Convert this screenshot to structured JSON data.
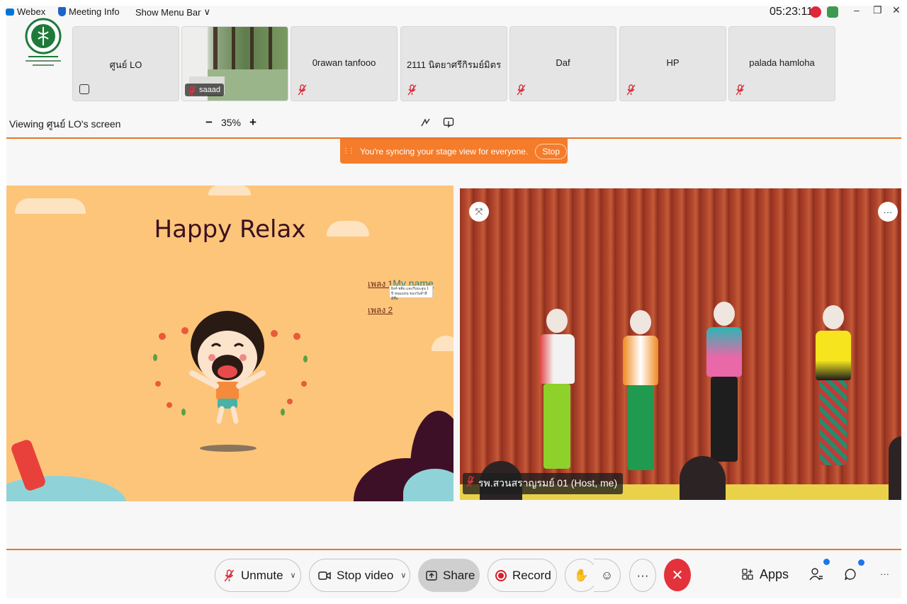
{
  "titlebar": {
    "app_name": "Webex",
    "meeting_info": "Meeting Info",
    "show_menu_bar": "Show Menu Bar",
    "clock": "05:23:11",
    "minimize": "–",
    "restore": "❐",
    "close": "✕"
  },
  "participants": [
    {
      "name": "ศูนย์ LO",
      "state": "sharing"
    },
    {
      "name": "saaad",
      "state": "video"
    },
    {
      "name": "0rawan tanfooo",
      "state": "muted"
    },
    {
      "name": "2111 นิตยาศรีกิรมย์มิตร",
      "state": "muted"
    },
    {
      "name": "Daf",
      "state": "muted"
    },
    {
      "name": "HP",
      "state": "muted"
    },
    {
      "name": "palada hamloha",
      "state": "muted"
    }
  ],
  "viewing": {
    "label": "Viewing ศูนย์ LO's screen",
    "zoom_minus": "−",
    "zoom_level": "35%",
    "zoom_plus": "+"
  },
  "sync_banner": {
    "grip": "⋮⋮",
    "text": "You're syncing your stage view for everyone.",
    "stop_label": "Stop"
  },
  "slide": {
    "title": "Happy Relax",
    "song1": "เพลง 1",
    "song1_extra": "My name",
    "song2": "เพลง 2",
    "tooltip": "ผิงค์ พลิ่ม และกีบมะลูน 1 ปี ขนมแทน ของวันทำที่มีชื่อ"
  },
  "video": {
    "host_label": "รพ.สวนสราญรมย์ 01 (Host, me)",
    "unpin_icon": "⤧",
    "more_icon": "···"
  },
  "controls": {
    "unmute": "Unmute",
    "stop_video": "Stop video",
    "share": "Share",
    "record": "Record",
    "raise_hand": "✋",
    "reactions": "☺",
    "more": "···",
    "end": "✕",
    "apps": "Apps",
    "participants_icon": "👤",
    "chat_icon": "💬",
    "overflow": "···",
    "chevron": "∨"
  },
  "colors": {
    "accent_orange": "#f47c2a",
    "end_red": "#e3323b",
    "badge_blue": "#1c76e8"
  }
}
